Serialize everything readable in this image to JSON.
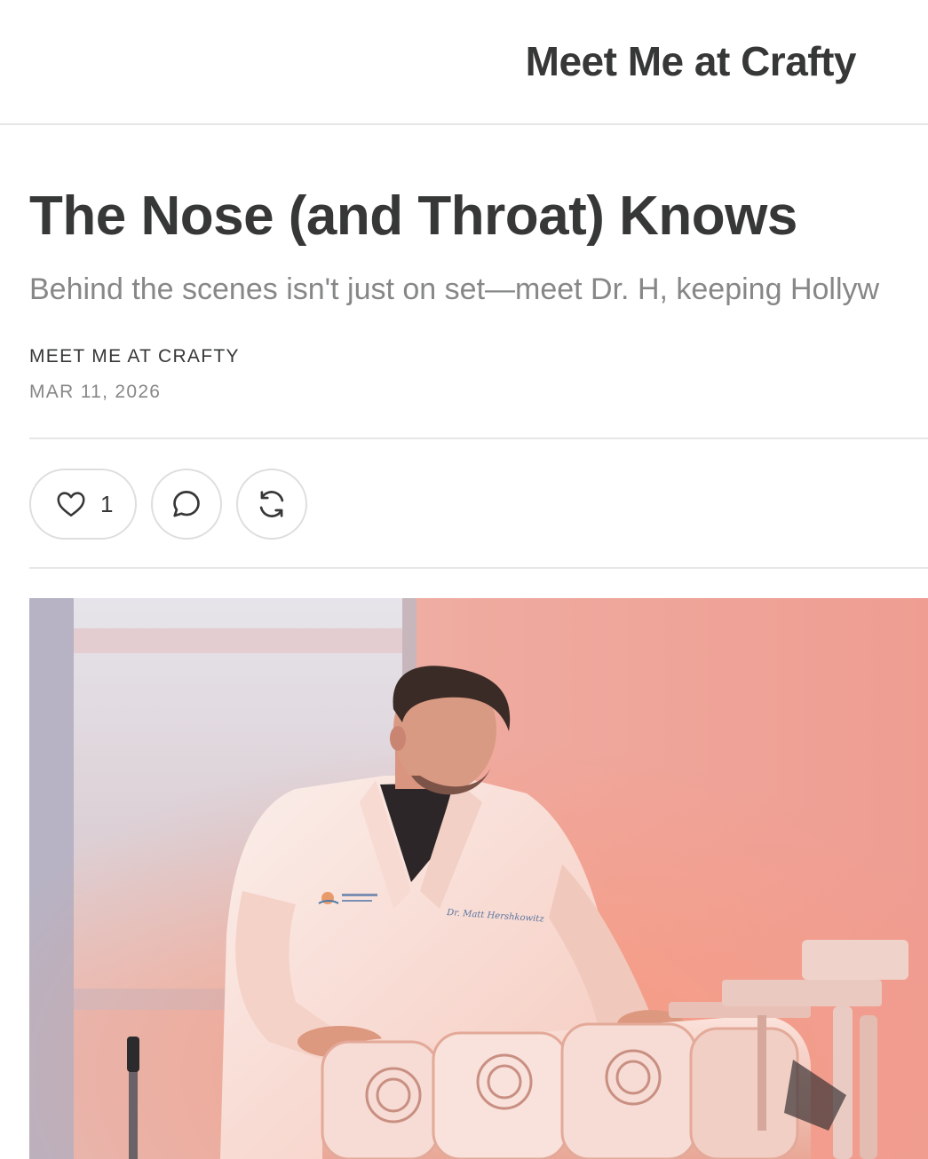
{
  "header": {
    "publication_name": "Meet Me at Crafty"
  },
  "post": {
    "title": "The Nose (and Throat) Knows",
    "subtitle": "Behind the scenes isn't just on set—meet Dr. H, keeping Hollyw",
    "author": "MEET ME AT CRAFTY",
    "date": "MAR 11, 2026"
  },
  "actions": {
    "like_count": "1",
    "like_icon": "heart-icon",
    "comment_icon": "comment-icon",
    "restack_icon": "restack-icon"
  },
  "hero_image": {
    "description_icon": "photo",
    "coat_embroidery": "Dr. Matt Hershkowitz"
  },
  "colors": {
    "text": "#363737",
    "muted": "#868787",
    "divider": "#e6e6e6"
  }
}
